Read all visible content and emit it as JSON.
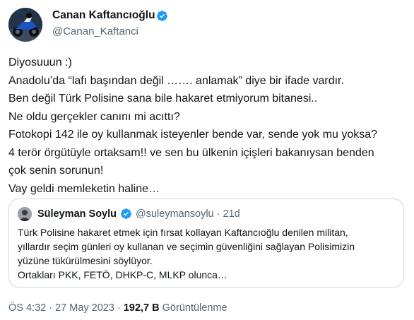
{
  "author": {
    "name": "Canan Kaftancıoğlu",
    "handle": "@Canan_Kaftanci",
    "avatar_icon": "avatar-motorcycle",
    "verified_icon": "verified-badge-icon"
  },
  "tweet": {
    "lines": [
      "Diyosuuun :)",
      "Anadolu’da “lafı başından değil ……. anlamak” diye bir ifade vardır.",
      "Ben değil Türk Polisine sana bile hakaret etmiyorum bitanesi..",
      "Ne oldu gerçekler canını mi acıttı?",
      "Fotokopi 142 ile oy kullanmak isteyenler bende var, sende yok mu yoksa?",
      "4 terör örgütüyle ortaksam!! ve sen bu ülkenin içişleri bakanıysan benden",
      "çok senin sorunun!",
      "Vay geldi memleketin haline…"
    ]
  },
  "quote": {
    "name": "Süleyman Soylu",
    "handle": "@suleymansoylu",
    "separator": "·",
    "time": "21d",
    "lines": [
      "Türk Polisine hakaret etmek için fırsat kollayan Kaftancıoğlu denilen militan,",
      "yıllardır seçim günleri oy kullanan ve seçimin güvenliğini sağlayan Polisimizin",
      "yüzüne tükürülmesini söylüyor.",
      "Ortakları PKK, FETÖ, DHKP-C, MLKP olunca…"
    ]
  },
  "meta": {
    "time": "ÖS 4:32",
    "dot1": " · ",
    "date": "27 May 2023",
    "dot2": " · ",
    "views_count": "192,7 B",
    "views_label": " Görüntülenme"
  },
  "colors": {
    "text": "#0f1419",
    "secondary": "#536471",
    "verified": "#1d9bf0",
    "border": "#cfd9de"
  }
}
